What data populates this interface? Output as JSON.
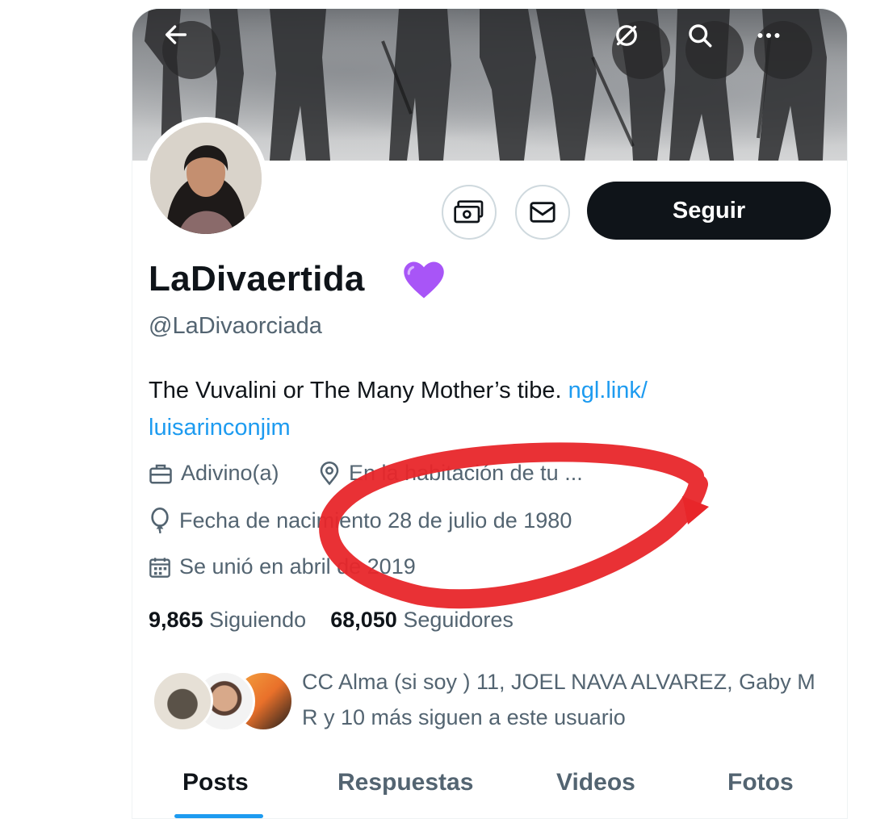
{
  "profile": {
    "display_name": "LaDivaertida",
    "handle": "@LaDivaorciada",
    "bio_text": "The Vuvalini or The Many Mother’s tibe. ",
    "bio_link_line1": "ngl.link/",
    "bio_link_line2": "luisarinconjim",
    "profession": "Adivino(a)",
    "location": "En la habitación de tu ...",
    "birthday": "Fecha de nacimiento 28 de julio de 1980",
    "joined": "Se unió en abril de 2019",
    "following_count": "9,865",
    "following_label": "Siguiendo",
    "followers_count": "68,050",
    "followers_label": "Seguidores",
    "followed_by_text": "CC Alma (si soy ) 11, JOEL NAVA ALVAREZ, Gaby M R y 10 más siguen a este usuario"
  },
  "actions": {
    "follow_label": "Seguir"
  },
  "tabs": [
    {
      "label": "Posts",
      "active": true
    },
    {
      "label": "Respuestas",
      "active": false
    },
    {
      "label": "Videos",
      "active": false
    },
    {
      "label": "Fotos",
      "active": false
    }
  ],
  "icons": {
    "back": "arrow-left-icon",
    "grok": "grok-icon",
    "search": "search-icon",
    "more": "more-icon",
    "subscribe": "money-icon",
    "message": "envelope-icon",
    "verified_emoji": "purple-heart-icon",
    "profession": "briefcase-icon",
    "location": "location-pin-icon",
    "birthday": "balloon-icon",
    "joined": "calendar-icon"
  },
  "colors": {
    "accent": "#1d9bf0",
    "text_primary": "#0f1419",
    "text_secondary": "#536471",
    "follow_button": "#0f1419",
    "annotation_red": "#e8262a",
    "heart": "#a855f7"
  }
}
